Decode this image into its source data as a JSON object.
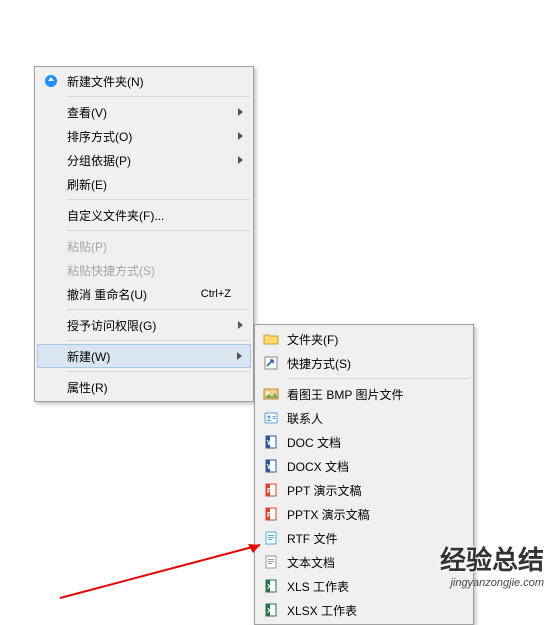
{
  "menu1": {
    "new_folder": "新建文件夹(N)",
    "view": "查看(V)",
    "sort": "排序方式(O)",
    "group": "分组依据(P)",
    "refresh": "刷新(E)",
    "customize": "自定义文件夹(F)...",
    "paste": "粘贴(P)",
    "paste_shortcut": "粘贴快捷方式(S)",
    "undo": "撤消 重命名(U)",
    "undo_key": "Ctrl+Z",
    "access": "授予访问权限(G)",
    "new": "新建(W)",
    "properties": "属性(R)"
  },
  "menu2": {
    "folder": "文件夹(F)",
    "shortcut": "快捷方式(S)",
    "bmp": "看图王 BMP 图片文件",
    "contact": "联系人",
    "doc": "DOC 文档",
    "docx": "DOCX 文档",
    "ppt": "PPT 演示文稿",
    "pptx": "PPTX 演示文稿",
    "rtf": "RTF 文件",
    "txt": "文本文档",
    "xls": "XLS 工作表",
    "xlsx": "XLSX 工作表"
  },
  "watermark": {
    "title": "经验总结",
    "url": "jingyanzongjie.com"
  }
}
